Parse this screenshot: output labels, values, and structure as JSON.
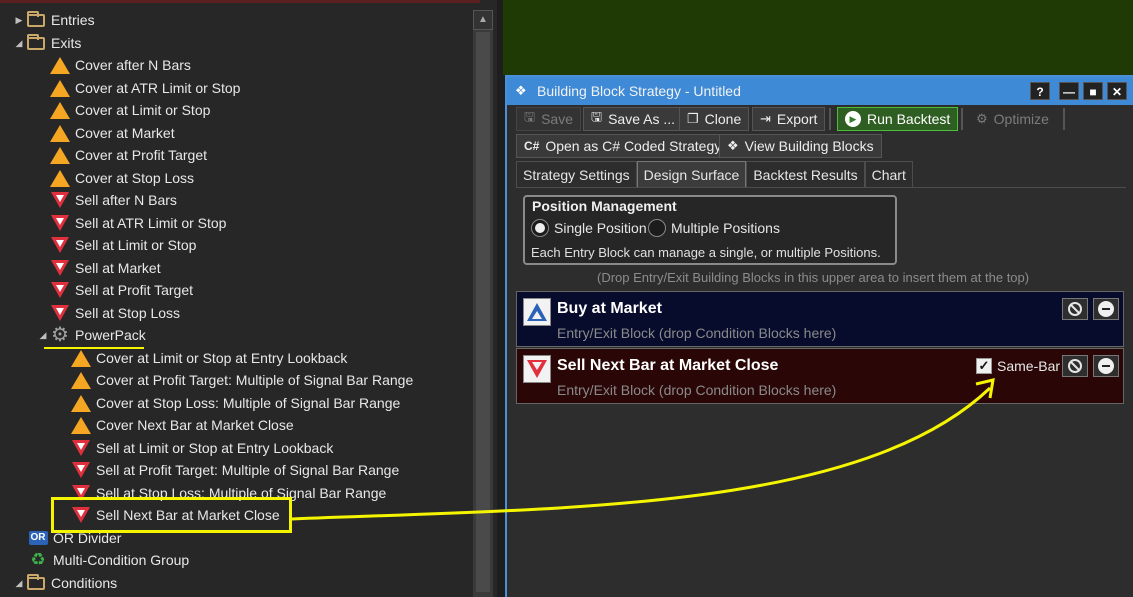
{
  "tree": {
    "items": [
      {
        "label": "Entries",
        "icon": "folder-icon",
        "toggle": "▶"
      },
      {
        "label": "Exits",
        "icon": "folder-open-icon",
        "toggle": "◢"
      },
      {
        "label": "Cover after N Bars",
        "icon": "warning-triangle-icon"
      },
      {
        "label": "Cover at ATR Limit or Stop",
        "icon": "warning-triangle-icon"
      },
      {
        "label": "Cover at Limit or Stop",
        "icon": "warning-triangle-icon"
      },
      {
        "label": "Cover at Market",
        "icon": "warning-triangle-icon"
      },
      {
        "label": "Cover at Profit Target",
        "icon": "warning-triangle-icon"
      },
      {
        "label": "Cover at Stop Loss",
        "icon": "warning-triangle-icon"
      },
      {
        "label": "Sell after N Bars",
        "icon": "sell-triangle-icon"
      },
      {
        "label": "Sell at ATR Limit or Stop",
        "icon": "sell-triangle-icon"
      },
      {
        "label": "Sell at Limit or Stop",
        "icon": "sell-triangle-icon"
      },
      {
        "label": "Sell at Market",
        "icon": "sell-triangle-icon"
      },
      {
        "label": "Sell at Profit Target",
        "icon": "sell-triangle-icon"
      },
      {
        "label": "Sell at Stop Loss",
        "icon": "sell-triangle-icon"
      },
      {
        "label": "PowerPack",
        "icon": "gear-icon",
        "toggle": "◢"
      },
      {
        "label": "Cover at Limit or Stop at Entry Lookback",
        "icon": "warning-triangle-icon"
      },
      {
        "label": "Cover at Profit Target: Multiple of Signal Bar Range",
        "icon": "warning-triangle-icon"
      },
      {
        "label": "Cover at Stop Loss: Multiple of Signal Bar Range",
        "icon": "warning-triangle-icon"
      },
      {
        "label": "Cover Next Bar at Market Close",
        "icon": "warning-triangle-icon"
      },
      {
        "label": "Sell at Limit or Stop at Entry Lookback",
        "icon": "sell-triangle-icon"
      },
      {
        "label": "Sell at Profit Target: Multiple of Signal Bar Range",
        "icon": "sell-triangle-icon"
      },
      {
        "label": "Sell at Stop Loss: Multiple of Signal Bar Range",
        "icon": "sell-triangle-icon"
      },
      {
        "label": "Sell Next Bar at Market Close",
        "icon": "sell-triangle-icon"
      },
      {
        "label": "OR Divider",
        "icon": "or-icon",
        "icon_text": "OR"
      },
      {
        "label": "Multi-Condition Group",
        "icon": "recycle-icon"
      },
      {
        "label": "Conditions",
        "icon": "folder-open-icon",
        "toggle": "◢"
      }
    ]
  },
  "window": {
    "title": "Building Block Strategy - Untitled",
    "buttons": {
      "help": "?",
      "minimize": "—",
      "maximize": "■",
      "close": "✕"
    }
  },
  "toolbar": {
    "save": "Save",
    "save_as": "Save As ...",
    "clone": "Clone",
    "export": "Export",
    "run_backtest": "Run Backtest",
    "optimize": "Optimize",
    "open_csharp_prefix": "C#",
    "open_csharp": "Open as C# Coded Strategy",
    "view_blocks": "View Building Blocks"
  },
  "tabs": [
    "Strategy Settings",
    "Design Surface",
    "Backtest Results",
    "Chart"
  ],
  "active_tab": "Design Surface",
  "position_management": {
    "title": "Position Management",
    "single": "Single Position",
    "multiple": "Multiple Positions",
    "selected": "Single Position",
    "description": "Each Entry Block can manage a single, or multiple Positions."
  },
  "drop_hint": "(Drop Entry/Exit Building Blocks in this upper area to insert them at the top)",
  "blocks": [
    {
      "title": "Buy at Market",
      "subtitle": "Entry/Exit Block (drop Condition Blocks here)",
      "color": "#070b2c"
    },
    {
      "title": "Sell Next Bar at Market Close",
      "subtitle": "Entry/Exit Block (drop Condition Blocks here)",
      "same_bar_label": "Same-Bar",
      "same_bar_checked": true,
      "color": "#2a0606"
    }
  ],
  "colors": {
    "accent": "#3e8ad6",
    "annotation": "#f5f500",
    "run_button": "#4bbf3a",
    "chart_background": "#1f3a05"
  }
}
